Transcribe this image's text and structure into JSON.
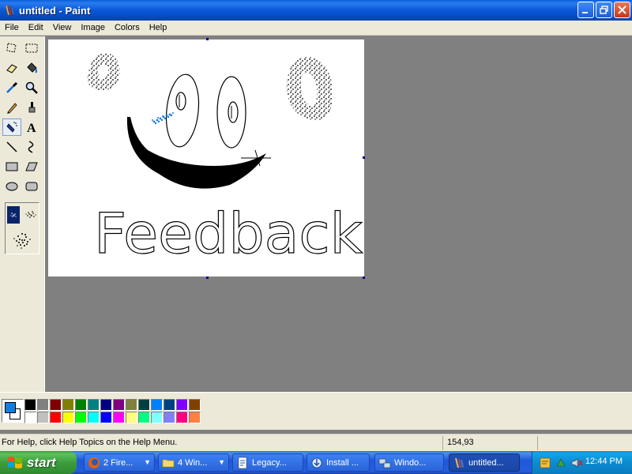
{
  "window": {
    "title": "untitled - Paint"
  },
  "menu": [
    "File",
    "Edit",
    "View",
    "Image",
    "Colors",
    "Help"
  ],
  "tools": [
    "free-form-select",
    "select",
    "eraser",
    "fill-with-color",
    "pick-color",
    "magnifier",
    "pencil",
    "brush",
    "airbrush",
    "text",
    "line",
    "curve",
    "rectangle",
    "polygon",
    "ellipse",
    "rounded-rectangle"
  ],
  "selected_tool": "airbrush",
  "canvas_text": "Feedback",
  "colors": {
    "foreground": "#0f7fe3",
    "background": "#ffffff",
    "palette_top": [
      "#000000",
      "#808080",
      "#800000",
      "#808000",
      "#008000",
      "#008080",
      "#000080",
      "#800080",
      "#808040",
      "#004040",
      "#0080ff",
      "#004080",
      "#8000ff",
      "#804000"
    ],
    "palette_bottom": [
      "#ffffff",
      "#c0c0c0",
      "#ff0000",
      "#ffff00",
      "#00ff00",
      "#00ffff",
      "#0000ff",
      "#ff00ff",
      "#ffff80",
      "#00ff80",
      "#80ffff",
      "#8080ff",
      "#ff0080",
      "#ff8040"
    ]
  },
  "status": {
    "help": "For Help, click Help Topics on the Help Menu.",
    "coords": "154,93"
  },
  "taskbar": {
    "start": "start",
    "tasks": [
      {
        "label": "2 Fire...",
        "icon": "firefox-icon",
        "group": true
      },
      {
        "label": "4 Win...",
        "icon": "folder-icon",
        "group": true
      },
      {
        "label": "Legacy...",
        "icon": "document-icon"
      },
      {
        "label": "Install ...",
        "icon": "install-icon"
      },
      {
        "label": "Windo...",
        "icon": "network-icon"
      },
      {
        "label": "untitled...",
        "icon": "paint-icon",
        "active": true
      }
    ],
    "clock": "12:44 PM"
  }
}
